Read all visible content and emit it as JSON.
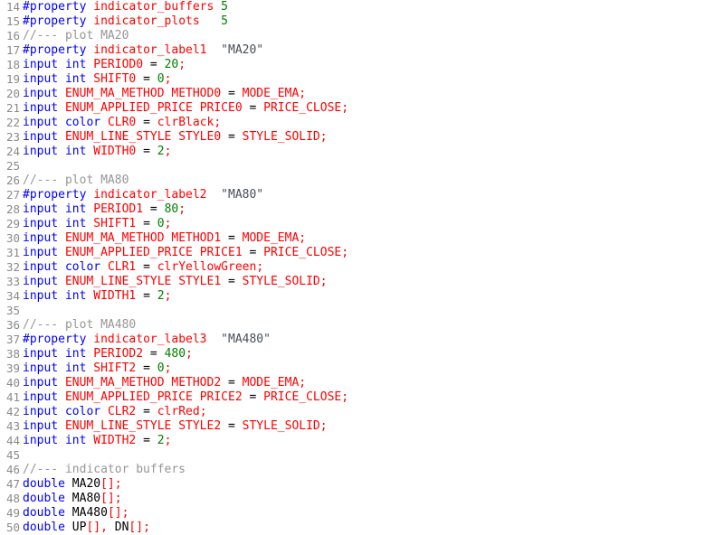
{
  "editor": {
    "language": "MQL5",
    "first_line_number": 14,
    "last_line_number": 50,
    "background": "#ffffff",
    "gutter_color": "#8a8a8a",
    "token_colors": {
      "keyword": "#0000ff",
      "preprocessor": "#0000ff",
      "identifier": "#ff0000",
      "number": "#008000",
      "punctuation": "#ff0000",
      "operator": "#000000",
      "plain": "#000000",
      "comment": "#969696",
      "string": "#46505a"
    }
  },
  "lines": [
    {
      "num": "14",
      "tokens": [
        {
          "t": "#property",
          "c": "pre"
        },
        {
          "t": " ",
          "c": "txt"
        },
        {
          "t": "indicator_buffers",
          "c": "id"
        },
        {
          "t": " ",
          "c": "txt"
        },
        {
          "t": "5",
          "c": "num"
        }
      ]
    },
    {
      "num": "15",
      "tokens": [
        {
          "t": "#property",
          "c": "pre"
        },
        {
          "t": " ",
          "c": "txt"
        },
        {
          "t": "indicator_plots",
          "c": "id"
        },
        {
          "t": "   ",
          "c": "txt"
        },
        {
          "t": "5",
          "c": "num"
        }
      ]
    },
    {
      "num": "16",
      "tokens": [
        {
          "t": "//--- plot MA20",
          "c": "cmt"
        }
      ]
    },
    {
      "num": "17",
      "tokens": [
        {
          "t": "#property",
          "c": "pre"
        },
        {
          "t": " ",
          "c": "txt"
        },
        {
          "t": "indicator_label1",
          "c": "id"
        },
        {
          "t": "  ",
          "c": "txt"
        },
        {
          "t": "\"MA20\"",
          "c": "str"
        }
      ]
    },
    {
      "num": "18",
      "tokens": [
        {
          "t": "input",
          "c": "kw"
        },
        {
          "t": " ",
          "c": "txt"
        },
        {
          "t": "int",
          "c": "kw"
        },
        {
          "t": " ",
          "c": "txt"
        },
        {
          "t": "PERIOD0",
          "c": "id"
        },
        {
          "t": " ",
          "c": "txt"
        },
        {
          "t": "=",
          "c": "op"
        },
        {
          "t": " ",
          "c": "txt"
        },
        {
          "t": "20",
          "c": "num"
        },
        {
          "t": ";",
          "c": "pun"
        }
      ]
    },
    {
      "num": "19",
      "tokens": [
        {
          "t": "input",
          "c": "kw"
        },
        {
          "t": " ",
          "c": "txt"
        },
        {
          "t": "int",
          "c": "kw"
        },
        {
          "t": " ",
          "c": "txt"
        },
        {
          "t": "SHIFT0",
          "c": "id"
        },
        {
          "t": " ",
          "c": "txt"
        },
        {
          "t": "=",
          "c": "op"
        },
        {
          "t": " ",
          "c": "txt"
        },
        {
          "t": "0",
          "c": "num"
        },
        {
          "t": ";",
          "c": "pun"
        }
      ]
    },
    {
      "num": "20",
      "tokens": [
        {
          "t": "input",
          "c": "kw"
        },
        {
          "t": " ",
          "c": "txt"
        },
        {
          "t": "ENUM_MA_METHOD",
          "c": "id"
        },
        {
          "t": " ",
          "c": "txt"
        },
        {
          "t": "METHOD0",
          "c": "id"
        },
        {
          "t": " ",
          "c": "txt"
        },
        {
          "t": "=",
          "c": "op"
        },
        {
          "t": " ",
          "c": "txt"
        },
        {
          "t": "MODE_EMA",
          "c": "id"
        },
        {
          "t": ";",
          "c": "pun"
        }
      ]
    },
    {
      "num": "21",
      "tokens": [
        {
          "t": "input",
          "c": "kw"
        },
        {
          "t": " ",
          "c": "txt"
        },
        {
          "t": "ENUM_APPLIED_PRICE",
          "c": "id"
        },
        {
          "t": " ",
          "c": "txt"
        },
        {
          "t": "PRICE0",
          "c": "id"
        },
        {
          "t": " ",
          "c": "txt"
        },
        {
          "t": "=",
          "c": "op"
        },
        {
          "t": " ",
          "c": "txt"
        },
        {
          "t": "PRICE_CLOSE",
          "c": "id"
        },
        {
          "t": ";",
          "c": "pun"
        }
      ]
    },
    {
      "num": "22",
      "tokens": [
        {
          "t": "input",
          "c": "kw"
        },
        {
          "t": " ",
          "c": "txt"
        },
        {
          "t": "color",
          "c": "kw"
        },
        {
          "t": " ",
          "c": "txt"
        },
        {
          "t": "CLR0",
          "c": "id"
        },
        {
          "t": " ",
          "c": "txt"
        },
        {
          "t": "=",
          "c": "op"
        },
        {
          "t": " ",
          "c": "txt"
        },
        {
          "t": "clrBlack",
          "c": "id"
        },
        {
          "t": ";",
          "c": "pun"
        }
      ]
    },
    {
      "num": "23",
      "tokens": [
        {
          "t": "input",
          "c": "kw"
        },
        {
          "t": " ",
          "c": "txt"
        },
        {
          "t": "ENUM_LINE_STYLE",
          "c": "id"
        },
        {
          "t": " ",
          "c": "txt"
        },
        {
          "t": "STYLE0",
          "c": "id"
        },
        {
          "t": " ",
          "c": "txt"
        },
        {
          "t": "=",
          "c": "op"
        },
        {
          "t": " ",
          "c": "txt"
        },
        {
          "t": "STYLE_SOLID",
          "c": "id"
        },
        {
          "t": ";",
          "c": "pun"
        }
      ]
    },
    {
      "num": "24",
      "tokens": [
        {
          "t": "input",
          "c": "kw"
        },
        {
          "t": " ",
          "c": "txt"
        },
        {
          "t": "int",
          "c": "kw"
        },
        {
          "t": " ",
          "c": "txt"
        },
        {
          "t": "WIDTH0",
          "c": "id"
        },
        {
          "t": " ",
          "c": "txt"
        },
        {
          "t": "=",
          "c": "op"
        },
        {
          "t": " ",
          "c": "txt"
        },
        {
          "t": "2",
          "c": "num"
        },
        {
          "t": ";",
          "c": "pun"
        }
      ]
    },
    {
      "num": "25",
      "tokens": []
    },
    {
      "num": "26",
      "tokens": [
        {
          "t": "//--- plot MA80",
          "c": "cmt"
        }
      ]
    },
    {
      "num": "27",
      "tokens": [
        {
          "t": "#property",
          "c": "pre"
        },
        {
          "t": " ",
          "c": "txt"
        },
        {
          "t": "indicator_label2",
          "c": "id"
        },
        {
          "t": "  ",
          "c": "txt"
        },
        {
          "t": "\"MA80\"",
          "c": "str"
        }
      ]
    },
    {
      "num": "28",
      "tokens": [
        {
          "t": "input",
          "c": "kw"
        },
        {
          "t": " ",
          "c": "txt"
        },
        {
          "t": "int",
          "c": "kw"
        },
        {
          "t": " ",
          "c": "txt"
        },
        {
          "t": "PERIOD1",
          "c": "id"
        },
        {
          "t": " ",
          "c": "txt"
        },
        {
          "t": "=",
          "c": "op"
        },
        {
          "t": " ",
          "c": "txt"
        },
        {
          "t": "80",
          "c": "num"
        },
        {
          "t": ";",
          "c": "pun"
        }
      ]
    },
    {
      "num": "29",
      "tokens": [
        {
          "t": "input",
          "c": "kw"
        },
        {
          "t": " ",
          "c": "txt"
        },
        {
          "t": "int",
          "c": "kw"
        },
        {
          "t": " ",
          "c": "txt"
        },
        {
          "t": "SHIFT1",
          "c": "id"
        },
        {
          "t": " ",
          "c": "txt"
        },
        {
          "t": "=",
          "c": "op"
        },
        {
          "t": " ",
          "c": "txt"
        },
        {
          "t": "0",
          "c": "num"
        },
        {
          "t": ";",
          "c": "pun"
        }
      ]
    },
    {
      "num": "30",
      "tokens": [
        {
          "t": "input",
          "c": "kw"
        },
        {
          "t": " ",
          "c": "txt"
        },
        {
          "t": "ENUM_MA_METHOD",
          "c": "id"
        },
        {
          "t": " ",
          "c": "txt"
        },
        {
          "t": "METHOD1",
          "c": "id"
        },
        {
          "t": " ",
          "c": "txt"
        },
        {
          "t": "=",
          "c": "op"
        },
        {
          "t": " ",
          "c": "txt"
        },
        {
          "t": "MODE_EMA",
          "c": "id"
        },
        {
          "t": ";",
          "c": "pun"
        }
      ]
    },
    {
      "num": "31",
      "tokens": [
        {
          "t": "input",
          "c": "kw"
        },
        {
          "t": " ",
          "c": "txt"
        },
        {
          "t": "ENUM_APPLIED_PRICE",
          "c": "id"
        },
        {
          "t": " ",
          "c": "txt"
        },
        {
          "t": "PRICE1",
          "c": "id"
        },
        {
          "t": " ",
          "c": "txt"
        },
        {
          "t": "=",
          "c": "op"
        },
        {
          "t": " ",
          "c": "txt"
        },
        {
          "t": "PRICE_CLOSE",
          "c": "id"
        },
        {
          "t": ";",
          "c": "pun"
        }
      ]
    },
    {
      "num": "32",
      "tokens": [
        {
          "t": "input",
          "c": "kw"
        },
        {
          "t": " ",
          "c": "txt"
        },
        {
          "t": "color",
          "c": "kw"
        },
        {
          "t": " ",
          "c": "txt"
        },
        {
          "t": "CLR1",
          "c": "id"
        },
        {
          "t": " ",
          "c": "txt"
        },
        {
          "t": "=",
          "c": "op"
        },
        {
          "t": " ",
          "c": "txt"
        },
        {
          "t": "clrYellowGreen",
          "c": "id"
        },
        {
          "t": ";",
          "c": "pun"
        }
      ]
    },
    {
      "num": "33",
      "tokens": [
        {
          "t": "input",
          "c": "kw"
        },
        {
          "t": " ",
          "c": "txt"
        },
        {
          "t": "ENUM_LINE_STYLE",
          "c": "id"
        },
        {
          "t": " ",
          "c": "txt"
        },
        {
          "t": "STYLE1",
          "c": "id"
        },
        {
          "t": " ",
          "c": "txt"
        },
        {
          "t": "=",
          "c": "op"
        },
        {
          "t": " ",
          "c": "txt"
        },
        {
          "t": "STYLE_SOLID",
          "c": "id"
        },
        {
          "t": ";",
          "c": "pun"
        }
      ]
    },
    {
      "num": "34",
      "tokens": [
        {
          "t": "input",
          "c": "kw"
        },
        {
          "t": " ",
          "c": "txt"
        },
        {
          "t": "int",
          "c": "kw"
        },
        {
          "t": " ",
          "c": "txt"
        },
        {
          "t": "WIDTH1",
          "c": "id"
        },
        {
          "t": " ",
          "c": "txt"
        },
        {
          "t": "=",
          "c": "op"
        },
        {
          "t": " ",
          "c": "txt"
        },
        {
          "t": "2",
          "c": "num"
        },
        {
          "t": ";",
          "c": "pun"
        }
      ]
    },
    {
      "num": "35",
      "tokens": []
    },
    {
      "num": "36",
      "tokens": [
        {
          "t": "//--- plot MA480",
          "c": "cmt"
        }
      ]
    },
    {
      "num": "37",
      "tokens": [
        {
          "t": "#property",
          "c": "pre"
        },
        {
          "t": " ",
          "c": "txt"
        },
        {
          "t": "indicator_label3",
          "c": "id"
        },
        {
          "t": "  ",
          "c": "txt"
        },
        {
          "t": "\"MA480\"",
          "c": "str"
        }
      ]
    },
    {
      "num": "38",
      "tokens": [
        {
          "t": "input",
          "c": "kw"
        },
        {
          "t": " ",
          "c": "txt"
        },
        {
          "t": "int",
          "c": "kw"
        },
        {
          "t": " ",
          "c": "txt"
        },
        {
          "t": "PERIOD2",
          "c": "id"
        },
        {
          "t": " ",
          "c": "txt"
        },
        {
          "t": "=",
          "c": "op"
        },
        {
          "t": " ",
          "c": "txt"
        },
        {
          "t": "480",
          "c": "num"
        },
        {
          "t": ";",
          "c": "pun"
        }
      ]
    },
    {
      "num": "39",
      "tokens": [
        {
          "t": "input",
          "c": "kw"
        },
        {
          "t": " ",
          "c": "txt"
        },
        {
          "t": "int",
          "c": "kw"
        },
        {
          "t": " ",
          "c": "txt"
        },
        {
          "t": "SHIFT2",
          "c": "id"
        },
        {
          "t": " ",
          "c": "txt"
        },
        {
          "t": "=",
          "c": "op"
        },
        {
          "t": " ",
          "c": "txt"
        },
        {
          "t": "0",
          "c": "num"
        },
        {
          "t": ";",
          "c": "pun"
        }
      ]
    },
    {
      "num": "40",
      "tokens": [
        {
          "t": "input",
          "c": "kw"
        },
        {
          "t": " ",
          "c": "txt"
        },
        {
          "t": "ENUM_MA_METHOD",
          "c": "id"
        },
        {
          "t": " ",
          "c": "txt"
        },
        {
          "t": "METHOD2",
          "c": "id"
        },
        {
          "t": " ",
          "c": "txt"
        },
        {
          "t": "=",
          "c": "op"
        },
        {
          "t": " ",
          "c": "txt"
        },
        {
          "t": "MODE_EMA",
          "c": "id"
        },
        {
          "t": ";",
          "c": "pun"
        }
      ]
    },
    {
      "num": "41",
      "tokens": [
        {
          "t": "input",
          "c": "kw"
        },
        {
          "t": " ",
          "c": "txt"
        },
        {
          "t": "ENUM_APPLIED_PRICE",
          "c": "id"
        },
        {
          "t": " ",
          "c": "txt"
        },
        {
          "t": "PRICE2",
          "c": "id"
        },
        {
          "t": " ",
          "c": "txt"
        },
        {
          "t": "=",
          "c": "op"
        },
        {
          "t": " ",
          "c": "txt"
        },
        {
          "t": "PRICE_CLOSE",
          "c": "id"
        },
        {
          "t": ";",
          "c": "pun"
        }
      ]
    },
    {
      "num": "42",
      "tokens": [
        {
          "t": "input",
          "c": "kw"
        },
        {
          "t": " ",
          "c": "txt"
        },
        {
          "t": "color",
          "c": "kw"
        },
        {
          "t": " ",
          "c": "txt"
        },
        {
          "t": "CLR2",
          "c": "id"
        },
        {
          "t": " ",
          "c": "txt"
        },
        {
          "t": "=",
          "c": "op"
        },
        {
          "t": " ",
          "c": "txt"
        },
        {
          "t": "clrRed",
          "c": "id"
        },
        {
          "t": ";",
          "c": "pun"
        }
      ]
    },
    {
      "num": "43",
      "tokens": [
        {
          "t": "input",
          "c": "kw"
        },
        {
          "t": " ",
          "c": "txt"
        },
        {
          "t": "ENUM_LINE_STYLE",
          "c": "id"
        },
        {
          "t": " ",
          "c": "txt"
        },
        {
          "t": "STYLE2",
          "c": "id"
        },
        {
          "t": " ",
          "c": "txt"
        },
        {
          "t": "=",
          "c": "op"
        },
        {
          "t": " ",
          "c": "txt"
        },
        {
          "t": "STYLE_SOLID",
          "c": "id"
        },
        {
          "t": ";",
          "c": "pun"
        }
      ]
    },
    {
      "num": "44",
      "tokens": [
        {
          "t": "input",
          "c": "kw"
        },
        {
          "t": " ",
          "c": "txt"
        },
        {
          "t": "int",
          "c": "kw"
        },
        {
          "t": " ",
          "c": "txt"
        },
        {
          "t": "WIDTH2",
          "c": "id"
        },
        {
          "t": " ",
          "c": "txt"
        },
        {
          "t": "=",
          "c": "op"
        },
        {
          "t": " ",
          "c": "txt"
        },
        {
          "t": "2",
          "c": "num"
        },
        {
          "t": ";",
          "c": "pun"
        }
      ]
    },
    {
      "num": "45",
      "tokens": []
    },
    {
      "num": "46",
      "tokens": [
        {
          "t": "//--- indicator buffers",
          "c": "cmt"
        }
      ]
    },
    {
      "num": "47",
      "tokens": [
        {
          "t": "double",
          "c": "kw"
        },
        {
          "t": " ",
          "c": "txt"
        },
        {
          "t": "MA20",
          "c": "txt"
        },
        {
          "t": "[];",
          "c": "pun"
        }
      ]
    },
    {
      "num": "48",
      "tokens": [
        {
          "t": "double",
          "c": "kw"
        },
        {
          "t": " ",
          "c": "txt"
        },
        {
          "t": "MA80",
          "c": "txt"
        },
        {
          "t": "[];",
          "c": "pun"
        }
      ]
    },
    {
      "num": "49",
      "tokens": [
        {
          "t": "double",
          "c": "kw"
        },
        {
          "t": " ",
          "c": "txt"
        },
        {
          "t": "MA480",
          "c": "txt"
        },
        {
          "t": "[];",
          "c": "pun"
        }
      ]
    },
    {
      "num": "50",
      "tokens": [
        {
          "t": "double",
          "c": "kw"
        },
        {
          "t": " ",
          "c": "txt"
        },
        {
          "t": "UP",
          "c": "txt"
        },
        {
          "t": "[],",
          "c": "pun"
        },
        {
          "t": " ",
          "c": "txt"
        },
        {
          "t": "DN",
          "c": "txt"
        },
        {
          "t": "[];",
          "c": "pun"
        }
      ]
    }
  ]
}
